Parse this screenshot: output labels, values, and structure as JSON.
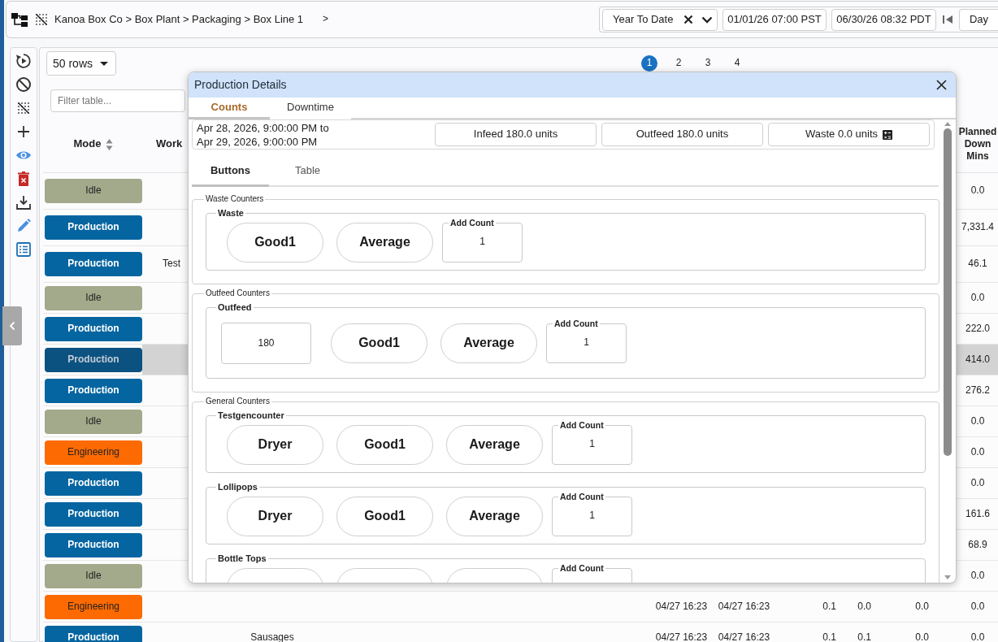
{
  "topbar": {
    "breadcrumb": "Kanoa Box Co > Box Plant > Packaging > Box Line 1",
    "breadcrumb_next": ">",
    "range": "Year To Date",
    "start": "01/01/26 07:00 PST",
    "end": "06/30/26 08:32 PDT",
    "interval": "Day"
  },
  "table": {
    "page_size": "50 rows",
    "pages": [
      {
        "label": "1",
        "selected": true
      },
      {
        "label": "2",
        "selected": false
      },
      {
        "label": "3",
        "selected": false
      },
      {
        "label": "4",
        "selected": false
      }
    ],
    "filter": {
      "placeholder": "Filter table..."
    },
    "columns": [
      {
        "label": "Mode",
        "sortable": true
      },
      {
        "label": "Work",
        "sortable": false
      },
      {
        "label": "Planned Down Mins",
        "sortable": false
      }
    ],
    "rows": [
      {
        "mode": "Idle",
        "color": "#a3a98b",
        "selected": false,
        "planned_down_mins": "0.0"
      },
      {
        "mode": "Production",
        "color": "#0565a1",
        "selected": false,
        "planned_down_mins": "7,331.4"
      },
      {
        "mode": "Production",
        "color": "#0565a1",
        "selected": false,
        "work": "Test",
        "planned_down_mins": "46.1"
      },
      {
        "mode": "Idle",
        "color": "#a3a98b",
        "selected": false,
        "planned_down_mins": "0.0"
      },
      {
        "mode": "Production",
        "color": "#0565a1",
        "selected": false,
        "planned_down_mins": "222.0"
      },
      {
        "mode": "Production",
        "color": "#0b5281",
        "selected": true,
        "planned_down_mins": "414.0"
      },
      {
        "mode": "Production",
        "color": "#0565a1",
        "selected": false,
        "planned_down_mins": "276.2"
      },
      {
        "mode": "Idle",
        "color": "#a3a98b",
        "selected": false,
        "planned_down_mins": "0.0"
      },
      {
        "mode": "Engineering",
        "color": "#fd6a02",
        "selected": false,
        "planned_down_mins": "0.0"
      },
      {
        "mode": "Production",
        "color": "#0565a1",
        "selected": false,
        "planned_down_mins": "0.0"
      },
      {
        "mode": "Production",
        "color": "#0565a1",
        "selected": false,
        "planned_down_mins": "161.6"
      },
      {
        "mode": "Production",
        "color": "#0565a1",
        "selected": false,
        "planned_down_mins": "68.9"
      },
      {
        "mode": "Idle",
        "color": "#a3a98b",
        "selected": false,
        "planned_down_mins": "0.0"
      },
      {
        "mode": "Engineering",
        "color": "#fd6a02",
        "selected": false,
        "column_4": "04/27 16:23",
        "column_5": "04/27 16:23",
        "column_6": "0.1",
        "column_7": "0.0",
        "column_8": "0.0",
        "planned_down_mins": "0.0"
      },
      {
        "mode": "Production",
        "color": "#0565a1",
        "selected": false,
        "column_3": "Sausages",
        "column_4": "04/27 16:23",
        "column_5": "04/27 16:23",
        "column_6": "0.1",
        "column_7": "0.1",
        "column_8": "0.0",
        "planned_down_mins": "0.0"
      }
    ]
  },
  "modal": {
    "title": "Production Details",
    "tabs": [
      {
        "label": "Counts",
        "selected": true
      },
      {
        "label": "Downtime",
        "selected": false
      }
    ],
    "range": "Apr 28, 2026, 9:00:00 PM to Apr 29, 2026, 9:00:00 PM",
    "totals": [
      {
        "label": "Infeed 180.0 units",
        "icon": false
      },
      {
        "label": "Outfeed 180.0 units",
        "icon": false
      },
      {
        "label": "Waste 0.0 units",
        "icon": true
      }
    ],
    "view_tabs": [
      {
        "label": "Buttons",
        "selected": true
      },
      {
        "label": "Table",
        "selected": false
      }
    ],
    "groups": [
      {
        "title": "Waste Counters",
        "counters": [
          {
            "name": "Waste",
            "controls": [
              {
                "kind": "pill",
                "label": "Good1"
              },
              {
                "kind": "pill",
                "label": "Average"
              },
              {
                "kind": "add",
                "label": "Add Count",
                "value": "1"
              }
            ]
          }
        ]
      },
      {
        "title": "Outfeed Counters",
        "counters": [
          {
            "name": "Outfeed",
            "controls": [
              {
                "kind": "value",
                "value": "180"
              },
              {
                "kind": "pill",
                "label": "Good1"
              },
              {
                "kind": "pill",
                "label": "Average"
              },
              {
                "kind": "add",
                "label": "Add Count",
                "value": "1"
              }
            ]
          }
        ]
      },
      {
        "title": "General Counters",
        "counters": [
          {
            "name": "Testgencounter",
            "controls": [
              {
                "kind": "pill",
                "label": "Dryer"
              },
              {
                "kind": "pill",
                "label": "Good1"
              },
              {
                "kind": "pill",
                "label": "Average"
              },
              {
                "kind": "add",
                "label": "Add Count",
                "value": "1"
              }
            ]
          },
          {
            "name": "Lollipops",
            "controls": [
              {
                "kind": "pill",
                "label": "Dryer"
              },
              {
                "kind": "pill",
                "label": "Good1"
              },
              {
                "kind": "pill",
                "label": "Average"
              },
              {
                "kind": "add",
                "label": "Add Count",
                "value": "1"
              }
            ]
          },
          {
            "name": "Bottle Tops",
            "controls": [
              {
                "kind": "pill"
              },
              {
                "kind": "pill"
              },
              {
                "kind": "pill"
              },
              {
                "kind": "add",
                "label": "Add Count"
              }
            ]
          }
        ]
      }
    ]
  }
}
